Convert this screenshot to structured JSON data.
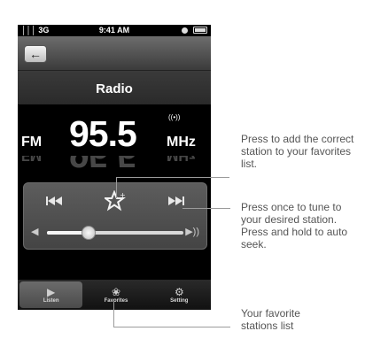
{
  "status": {
    "signal": "│││ 3G",
    "time": "9:41 AM"
  },
  "nav": {
    "back": "←"
  },
  "screen_title": "Radio",
  "tuner": {
    "band": "FM",
    "frequency": "95.5",
    "unit": "MHz",
    "signal_icon": "((•))"
  },
  "controls": {
    "prev": "⏮",
    "favorite": "☆",
    "next": "⏭"
  },
  "volume": {
    "level": 0.3,
    "low_icon": "◀",
    "high_icon": "▶))"
  },
  "tabs": [
    {
      "label": "Listen",
      "icon": "▶"
    },
    {
      "label": "Favorites",
      "icon": "❀"
    },
    {
      "label": "Setting",
      "icon": "⚙"
    }
  ],
  "annotations": {
    "favorite": "Press to add the correct station to your favorites list.",
    "seek": "Press once to tune to your desired station. Press and hold to auto seek.",
    "favorites_tab": "Your favorite stations list"
  }
}
